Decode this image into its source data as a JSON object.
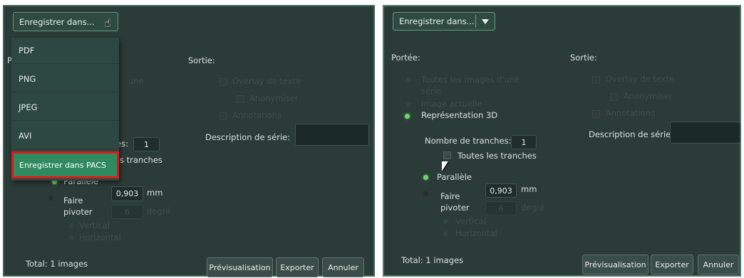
{
  "left": {
    "dropdown": {
      "label": "Enregistrer dans..."
    },
    "menu_items": [
      "PDF",
      "PNG",
      "JPEG",
      "AVI",
      "Enregistrer dans PACS"
    ],
    "partial_scope": "P",
    "partial_une": "une",
    "output_title": "Sortie:",
    "overlay": "Overlay de texte",
    "anonymize": "Anonymiser",
    "annotations": "Annotations",
    "series_desc": "Description de série:",
    "partial_slices_label": "es:",
    "slices_value": "1",
    "partial_all_slices": "s tranches",
    "parallel": "Parallèle",
    "rotate": "Faire pivoter",
    "mm_value": "0,903",
    "mm_unit": "mm",
    "degree_value": "6",
    "degree_unit": "degré",
    "vertical": "Vertical",
    "horizontal": "Horizontal",
    "total": "Total: 1 images",
    "preview": "Prévisualisation",
    "export": "Exporter",
    "cancel": "Annuler"
  },
  "right": {
    "dropdown": {
      "label": "Enregistrer dans..."
    },
    "scope_title": "Portée:",
    "all_series_images": "Toutes les images d'une série",
    "current_image": "Image actuelle",
    "representation_3d": "Représentation 3D",
    "slices_label": "Nombre de tranches:",
    "slices_value": "1",
    "all_slices": "Toutes les tranches",
    "parallel": "Parallèle",
    "rotate": "Faire pivoter",
    "mm_value": "0,903",
    "mm_unit": "mm",
    "degree_value": "6",
    "degree_unit": "degré",
    "vertical": "Vertical",
    "horizontal": "Horizontal",
    "output_title": "Sortie:",
    "overlay": "Overlay de texte",
    "anonymize": "Anonymiser",
    "annotations": "Annotations",
    "series_desc": "Description de série:",
    "total": "Total: 1 images",
    "preview": "Prévisualisation",
    "export": "Exporter",
    "cancel": "Annuler"
  },
  "colors": {
    "panel_bg": "#2b3b38",
    "accent_green": "#2f8a60",
    "highlight_red": "#e01818",
    "radio_on": "#6fd66f"
  }
}
